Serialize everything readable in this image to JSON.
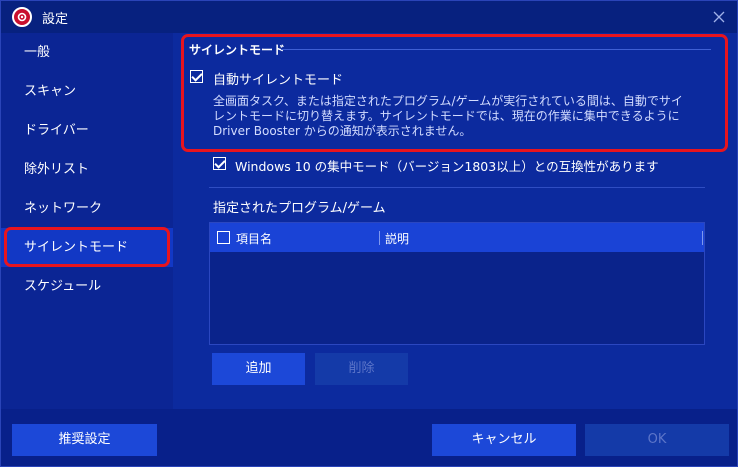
{
  "window": {
    "title": "設定"
  },
  "sidebar": {
    "items": [
      {
        "label": "一般"
      },
      {
        "label": "スキャン"
      },
      {
        "label": "ドライバー"
      },
      {
        "label": "除外リスト"
      },
      {
        "label": "ネットワーク"
      },
      {
        "label": "サイレントモード"
      },
      {
        "label": "スケジュール"
      }
    ],
    "active_index": 5
  },
  "main": {
    "section_title": "サイレントモード",
    "auto_silent": {
      "label": "自動サイレントモード",
      "checked": true,
      "description": [
        "全画面タスク、または指定されたプログラム/ゲームが実行されている間は、自動でサイ",
        "レントモードに切り替えます。サイレントモードでは、現在の作業に集中できるように",
        "Driver Booster からの通知が表示されません。"
      ]
    },
    "focus_mode": {
      "label": "Windows 10 の集中モード（バージョン1803以上）との互換性があります",
      "checked": true
    },
    "list": {
      "title": "指定されたプログラム/ゲーム",
      "columns": [
        "項目名",
        "説明"
      ],
      "rows": []
    },
    "add_label": "追加",
    "delete_label": "削除"
  },
  "footer": {
    "recommended_label": "推奨設定",
    "cancel_label": "キャンセル",
    "ok_label": "OK"
  },
  "colors": {
    "background": "#0c2a9e",
    "accent": "#1c48d8",
    "highlight": "#e8141e"
  }
}
